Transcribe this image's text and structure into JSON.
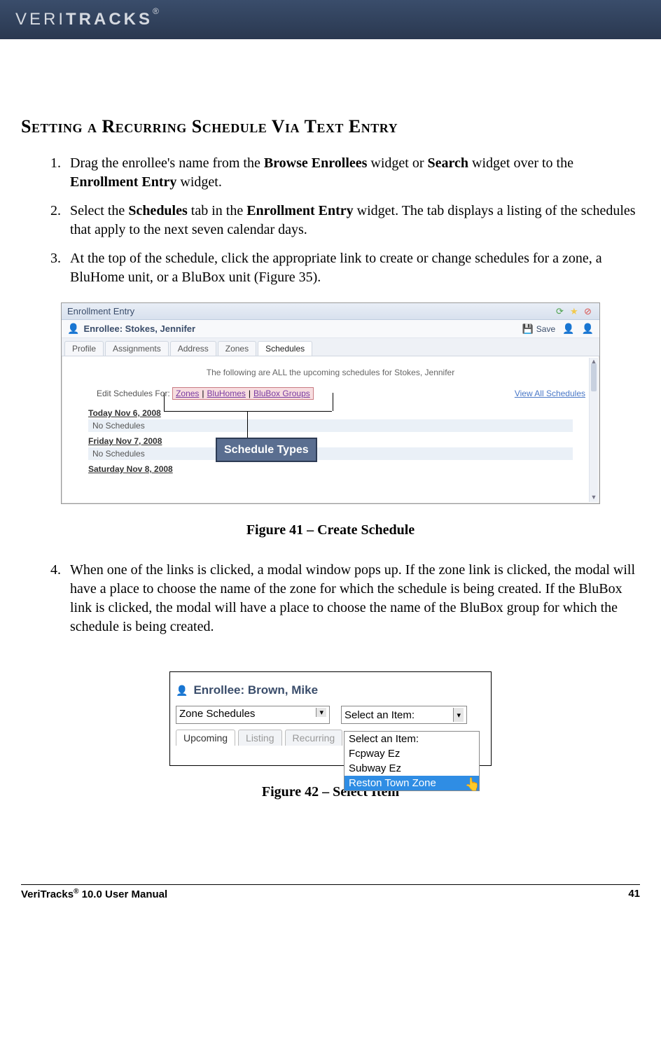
{
  "header": {
    "brand_thin": "VERI",
    "brand_bold": "TRACKS",
    "reg": "®"
  },
  "section_heading": "Setting a Recurring Schedule Via Text Entry",
  "steps": [
    {
      "pre": "Drag the enrollee's name from the ",
      "b1": "Browse Enrollees",
      "mid1": " widget or ",
      "b2": "Search",
      "mid2": " widget over to the ",
      "b3": "Enrollment Entry",
      "post": " widget."
    },
    {
      "pre": "Select the ",
      "b1": "Schedules",
      "mid1": " tab in the ",
      "b2": "Enrollment Entry",
      "post": " widget. The tab displays a listing of the schedules that apply to the next seven calendar days."
    },
    {
      "text": "At the top of the schedule, click the appropriate link to create or change schedules for a zone, a BluHome unit, or a BluBox unit (Figure 35)."
    },
    {
      "text": "When one of the links is clicked, a modal window pops up. If the zone link is clicked, the modal will have a place to choose the name of the zone for which the schedule is being created. If the BluBox link is clicked, the modal will have a place to choose the name of the BluBox group for which the schedule is being created."
    }
  ],
  "fig41": {
    "widget_title": "Enrollment Entry",
    "enrollee_label": "Enrollee: Stokes, Jennifer",
    "save_label": "Save",
    "tabs": [
      "Profile",
      "Assignments",
      "Address",
      "Zones",
      "Schedules"
    ],
    "active_tab_index": 4,
    "note": "The following are ALL the upcoming schedules for Stokes, Jennifer",
    "edit_label": "Edit Schedules For:",
    "schedule_types": [
      "Zones",
      "BluHomes",
      "BluBox Groups"
    ],
    "view_all": "View All Schedules",
    "days": [
      {
        "heading": "Today Nov 6, 2008",
        "value": "No Schedules"
      },
      {
        "heading": "Friday Nov 7, 2008",
        "value": "No Schedules"
      },
      {
        "heading": "Saturday Nov 8, 2008",
        "value": ""
      }
    ],
    "callout": "Schedule Types",
    "caption": "Figure 41 – Create Schedule"
  },
  "fig42": {
    "enrollee_label": "Enrollee: Brown, Mike",
    "left_select_value": "Zone Schedules",
    "right_select_value": "Select an Item:",
    "tabs": [
      "Upcoming",
      "Listing",
      "Recurring"
    ],
    "active_tab_index": 0,
    "options": [
      "Select an Item:",
      "Fcpway Ez",
      "Subway Ez",
      "Reston Town Zone"
    ],
    "selected_option_index": 3,
    "caption": "Figure 42 – Select Item"
  },
  "footer": {
    "left_pre": "VeriTracks",
    "sup": "®",
    "left_post": " 10.0 User Manual",
    "page": "41"
  }
}
